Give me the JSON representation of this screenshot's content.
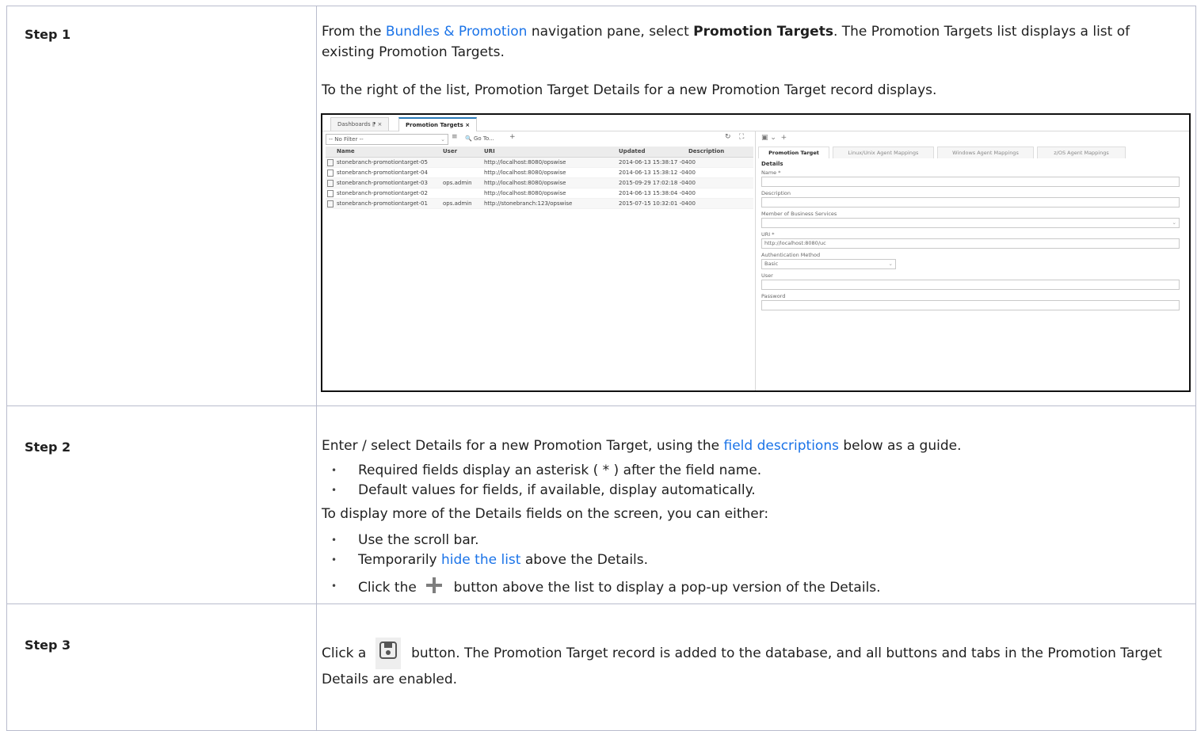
{
  "steps": [
    {
      "label": "Step 1",
      "p1_before": "From the ",
      "p1_link": "Bundles & Promotion",
      "p1_mid": " navigation pane, select ",
      "p1_bold": "Promotion Targets",
      "p1_after": ". The Promotion Targets list displays a list of existing Promotion Targets.",
      "p2": "To the right of the list, Promotion Target Details for a new Promotion Target record displays."
    },
    {
      "label": "Step 2",
      "p1_before": "Enter / select Details for a new Promotion Target, using the ",
      "p1_link": "field descriptions",
      "p1_after": " below as a guide.",
      "bullets1": [
        "Required fields display an asterisk ( * ) after the field name.",
        "Default values for fields, if available, display automatically."
      ],
      "p2": "To display more of the Details fields on the screen, you can either:",
      "b1": "Use the scroll bar.",
      "b2_before": "Temporarily ",
      "b2_link": "hide the list",
      "b2_after": " above the Details.",
      "b3_before": "Click the ",
      "b3_icon": "plus-icon",
      "b3_after": " button above the list to display a pop-up version of the Details."
    },
    {
      "label": "Step 3",
      "p1_before": "Click a ",
      "p1_icon": "save-icon",
      "p1_after": " button. The Promotion Target record is added to the database, and all buttons and tabs in the Promotion Target Details are enabled."
    }
  ],
  "screenshot": {
    "tabs": [
      "Dashboards ⁋ ×",
      "Promotion Targets ×"
    ],
    "filter": "-- No Filter --",
    "goto": "Go To...",
    "columns": [
      "Name",
      "User",
      "URI",
      "Updated",
      "Description"
    ],
    "rows": [
      [
        "stonebranch-promotiontarget-05",
        "",
        "http://localhost:8080/opswise",
        "2014-06-13 15:38:17 -0400",
        ""
      ],
      [
        "stonebranch-promotiontarget-04",
        "",
        "http://localhost:8080/opswise",
        "2014-06-13 15:38:12 -0400",
        ""
      ],
      [
        "stonebranch-promotiontarget-03",
        "ops.admin",
        "http://localhost:8080/opswise",
        "2015-09-29 17:02:18 -0400",
        ""
      ],
      [
        "stonebranch-promotiontarget-02",
        "",
        "http://localhost:8080/opswise",
        "2014-06-13 15:38:04 -0400",
        ""
      ],
      [
        "stonebranch-promotiontarget-01",
        "ops.admin",
        "http://stonebranch:123/opswise",
        "2015-07-15 10:32:01 -0400",
        ""
      ]
    ],
    "detail_tabs": [
      "Promotion Target",
      "Linux/Unix Agent Mappings",
      "Windows Agent Mappings",
      "z/OS Agent Mappings"
    ],
    "details_heading": "Details",
    "fields": {
      "name_label": "Name *",
      "description_label": "Description",
      "business_services_label": "Member of Business Services",
      "uri_label": "URI *",
      "uri_value": "http://localhost:8080/uc",
      "auth_label": "Authentication Method",
      "auth_value": "Basic",
      "user_label": "User",
      "password_label": "Password"
    }
  }
}
